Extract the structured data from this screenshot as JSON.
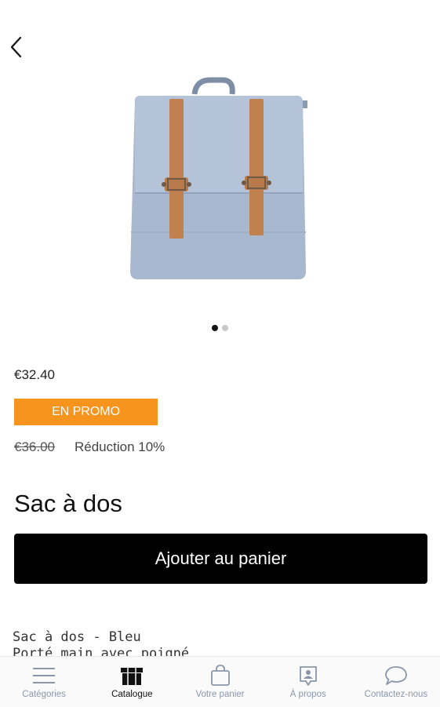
{
  "header": {
    "back_icon": "chevron-left-icon"
  },
  "gallery": {
    "image_count": 2,
    "active_index": 0
  },
  "product": {
    "price": "€32.40",
    "promo_badge": "EN PROMO",
    "old_price": "€36.00",
    "discount": "Réduction 10%",
    "title": "Sac à dos",
    "add_to_cart_label": "Ajouter au panier",
    "description": "Sac à dos - Bleu\nPorté main avec poigné"
  },
  "colors": {
    "promo": "#f7941d",
    "button": "#000000",
    "nav_inactive": "#8a97ab"
  },
  "nav": {
    "items": [
      {
        "label": "Catégories",
        "icon": "menu-icon",
        "active": false
      },
      {
        "label": "Catalogue",
        "icon": "catalog-box-icon",
        "active": true
      },
      {
        "label": "Votre panier",
        "icon": "shopping-bag-icon",
        "active": false
      },
      {
        "label": "À propos",
        "icon": "about-icon",
        "active": false
      },
      {
        "label": "Contactez-nous",
        "icon": "chat-icon",
        "active": false
      }
    ]
  }
}
